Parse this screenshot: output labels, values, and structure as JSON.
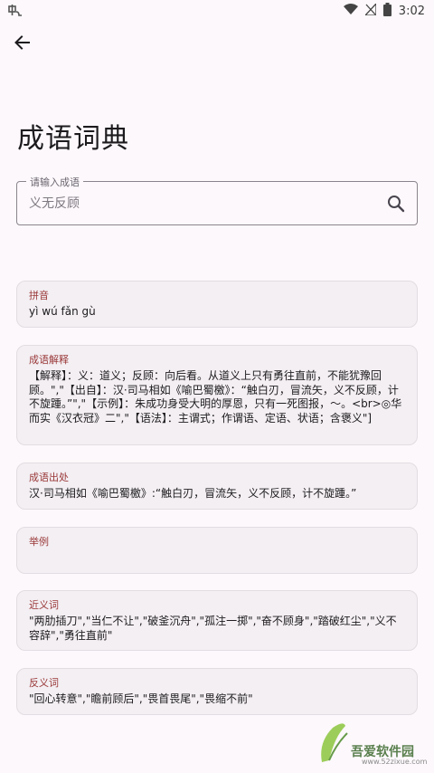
{
  "status_bar": {
    "time": "3:02"
  },
  "header": {
    "title": "成语词典"
  },
  "search": {
    "label": "请输入成语",
    "placeholder": "义无反顾"
  },
  "cards": [
    {
      "label": "拼音",
      "text": "yì wú fǎn gù"
    },
    {
      "label": "成语解释",
      "text": "【解释】：义：道义；反顾：向后看。从道义上只有勇往直前，不能犹豫回顾。\",\"【出自】：汉·司马相如《喻巴蜀檄》：“触白刃，冒流矢，义不反顾，计不旋踵。”\",\"【示例】：朱成功身受大明的厚恩，只有一死图报，～。<br>◎华而实《汉衣冠》二\",\"【语法】：主谓式；作谓语、定语、状语；含褒义\"]"
    },
    {
      "label": "成语出处",
      "text": "汉·司马相如《喻巴蜀檄》:“触白刃，冒流矢，义不反顾，计不旋踵。”"
    },
    {
      "label": "举例",
      "text": ""
    },
    {
      "label": "近义词",
      "text": "\"两肋插刀\",\"当仁不让\",\"破釜沉舟\",\"孤注一掷\",\"奋不顾身\",\"踏破红尘\",\"义不容辞\",\"勇往直前\""
    },
    {
      "label": "反义词",
      "text": "\"回心转意\",\"瞻前顾后\",\"畏首畏尾\",\"畏缩不前\""
    }
  ],
  "watermark": {
    "brand": "吾爱软件园",
    "url": "www.52zixue.com"
  },
  "icons": {
    "app": "app-logo-icon",
    "wifi": "wifi-icon",
    "signal": "signal-icon",
    "battery": "battery-icon",
    "back": "arrow-back-icon",
    "search": "search-icon"
  }
}
